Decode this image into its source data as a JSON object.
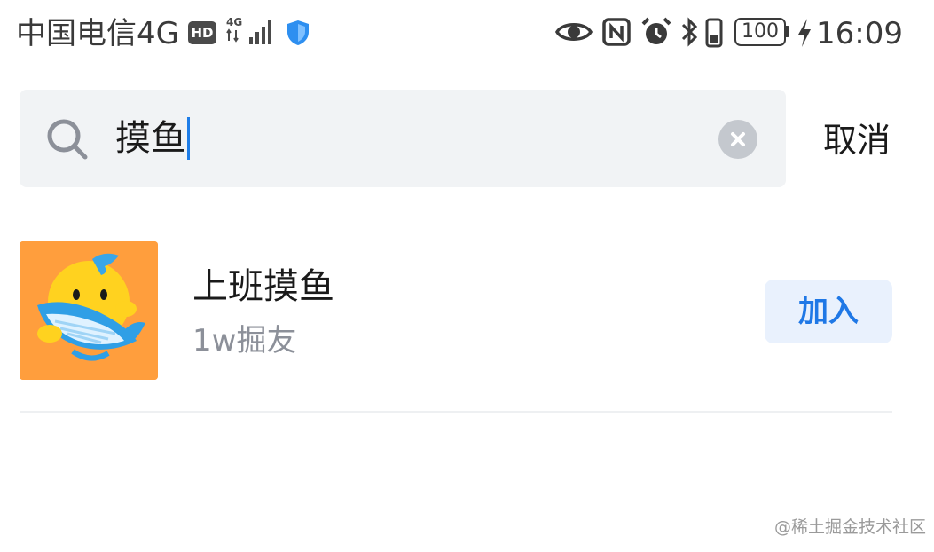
{
  "status_bar": {
    "carrier": "中国电信4G",
    "hd": "HD",
    "net_type": "4G",
    "battery": "100",
    "time": "16:09"
  },
  "search": {
    "query": "摸鱼",
    "cancel_label": "取消"
  },
  "results": [
    {
      "name": "上班摸鱼",
      "members": "1w掘友",
      "join_label": "加入"
    }
  ],
  "watermark": "@稀土掘金技术社区",
  "colors": {
    "accent": "#1f78e6",
    "avatar_bg": "#ff9e3d",
    "search_bg": "#f1f3f5"
  }
}
